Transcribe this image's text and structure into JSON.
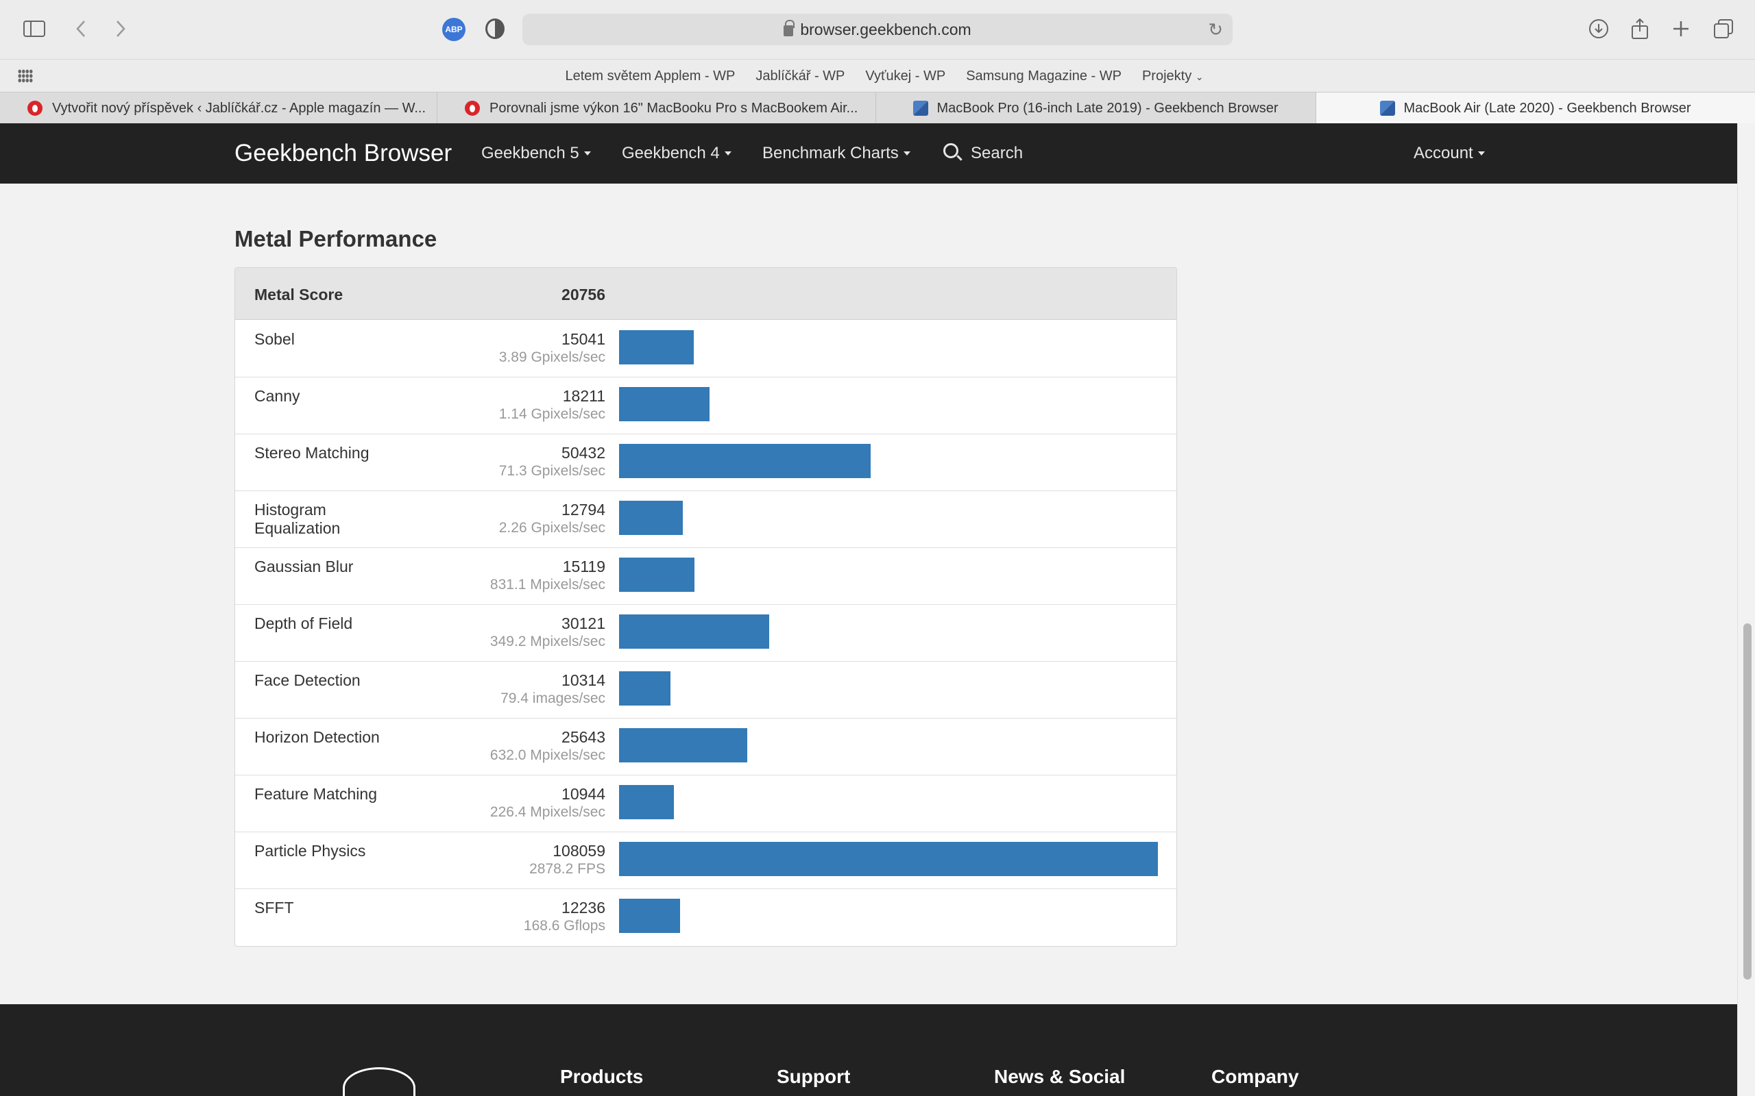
{
  "browser": {
    "url": "browser.geekbench.com",
    "bookmarks": [
      "Letem světem Applem - WP",
      "Jablíčkář - WP",
      "Vyťukej - WP",
      "Samsung Magazine - WP",
      "Projekty"
    ],
    "tabs": [
      {
        "title": "Vytvořit nový příspěvek ‹ Jablíčkář.cz - Apple magazín — W...",
        "favicon": "red-apple-icon"
      },
      {
        "title": "Porovnali jsme výkon 16\" MacBooku Pro s MacBookem Air...",
        "favicon": "red-apple-icon"
      },
      {
        "title": "MacBook Pro (16-inch Late 2019) - Geekbench Browser",
        "favicon": "geekbench-icon"
      },
      {
        "title": "MacBook Air (Late 2020) - Geekbench Browser",
        "favicon": "geekbench-icon"
      }
    ],
    "abp_label": "ABP"
  },
  "navbar": {
    "brand": "Geekbench Browser",
    "items": [
      "Geekbench 5",
      "Geekbench 4",
      "Benchmark Charts"
    ],
    "search": "Search",
    "account": "Account"
  },
  "section": {
    "title": "Metal Performance",
    "header_label": "Metal Score",
    "header_score": "20756"
  },
  "chart_data": {
    "type": "bar",
    "orientation": "horizontal",
    "categories": [
      "Sobel",
      "Canny",
      "Stereo Matching",
      "Histogram Equalization",
      "Gaussian Blur",
      "Depth of Field",
      "Face Detection",
      "Horizon Detection",
      "Feature Matching",
      "Particle Physics",
      "SFFT"
    ],
    "values": [
      15041,
      18211,
      50432,
      12794,
      15119,
      30121,
      10314,
      25643,
      10944,
      108059,
      12236
    ],
    "rates": [
      "3.89 Gpixels/sec",
      "1.14 Gpixels/sec",
      "71.3 Gpixels/sec",
      "2.26 Gpixels/sec",
      "831.1 Mpixels/sec",
      "349.2 Mpixels/sec",
      "79.4 images/sec",
      "632.0 Mpixels/sec",
      "226.4 Mpixels/sec",
      "2878.2 FPS",
      "168.6 Gflops"
    ],
    "xlim": [
      0,
      108059
    ],
    "color": "#337ab7"
  },
  "footer": {
    "columns": [
      "Products",
      "Support",
      "News & Social",
      "Company"
    ]
  }
}
